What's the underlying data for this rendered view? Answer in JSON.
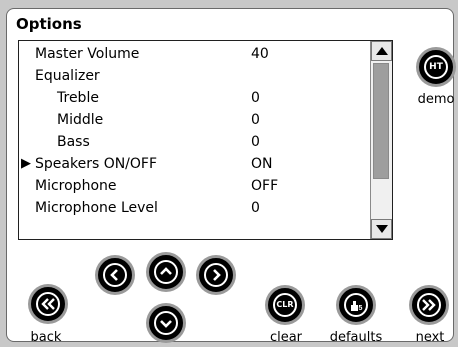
{
  "title": "Options",
  "rows": [
    {
      "label": "Master Volume",
      "value": "40",
      "indent": 0,
      "selected": false
    },
    {
      "label": "Equalizer",
      "value": "",
      "indent": 0,
      "selected": false
    },
    {
      "label": "Treble",
      "value": "0",
      "indent": 1,
      "selected": false
    },
    {
      "label": "Middle",
      "value": "0",
      "indent": 1,
      "selected": false
    },
    {
      "label": "Bass",
      "value": "0",
      "indent": 1,
      "selected": false
    },
    {
      "label": "Speakers ON/OFF",
      "value": "ON",
      "indent": 0,
      "selected": true
    },
    {
      "label": "Microphone",
      "value": "OFF",
      "indent": 0,
      "selected": false
    },
    {
      "label": "Microphone Level",
      "value": "0",
      "indent": 0,
      "selected": false
    }
  ],
  "selection_marker": "▶",
  "demo": {
    "icon_text": "HT",
    "label": "demo"
  },
  "buttons": {
    "back": {
      "label": "back"
    },
    "clear": {
      "icon_text": "CLR",
      "label": "clear"
    },
    "defaults": {
      "label": "defaults"
    },
    "next": {
      "label": "next"
    }
  },
  "colors": {
    "background": "#c8c8c8",
    "button": "#000000",
    "button_ring": "#9a9a9a"
  }
}
